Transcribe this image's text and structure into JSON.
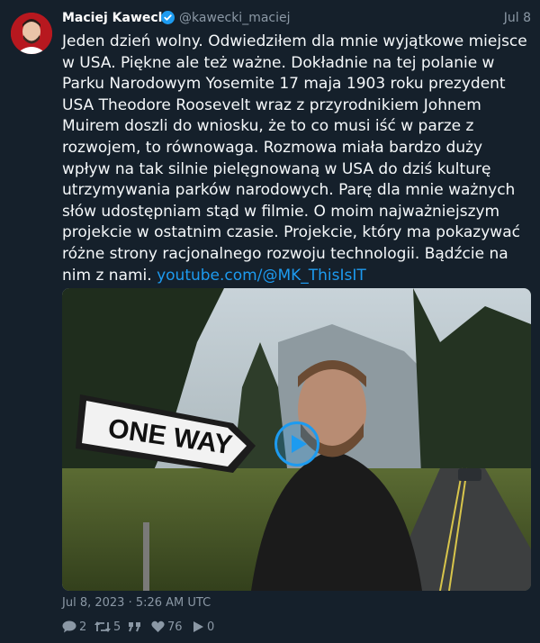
{
  "author": {
    "name": "Maciej Kawecki",
    "handle": "@kawecki_maciej"
  },
  "post": {
    "date_short": "Jul 8",
    "text": "Jeden dzień wolny. Odwiedziłem dla mnie wyjątkowe miejsce w USA. Piękne ale też ważne. Dokładnie na tej polanie w Parku Narodowym Yosemite 17 maja 1903 roku prezydent USA Theodore Roosevelt wraz z przyrodnikiem Johnem Muirem doszli do wniosku, że to co musi iść w parze z rozwojem, to równowaga. Rozmowa miała bardzo duży wpływ na tak silnie pielęgnowaną w USA do dziś kulturę utrzymywania parków narodowych. Parę dla mnie ważnych słów udostępniam stąd w filmie. O moim najważniejszym projekcie w ostatnim czasie. Projekcie, który ma pokazywać różne strony racjonalnego rozwoju technologii. Bądźcie na nim z nami.",
    "link": "youtube.com/@MK_ThisIsIT",
    "sign_text": "ONE WAY",
    "timestamp": "Jul 8, 2023 · 5:26 AM UTC"
  },
  "stats": {
    "replies": "2",
    "retweets": "5",
    "likes": "76",
    "views": "0"
  },
  "icons": {
    "verified": "verified-badge-icon",
    "play": "play-icon",
    "reply": "reply-icon",
    "retweet": "retweet-icon",
    "quote": "quote-icon",
    "like": "heart-icon",
    "views": "play-views-icon"
  },
  "colors": {
    "background": "#15202b",
    "accent": "#1d9bf0",
    "muted": "#8b98a5"
  }
}
